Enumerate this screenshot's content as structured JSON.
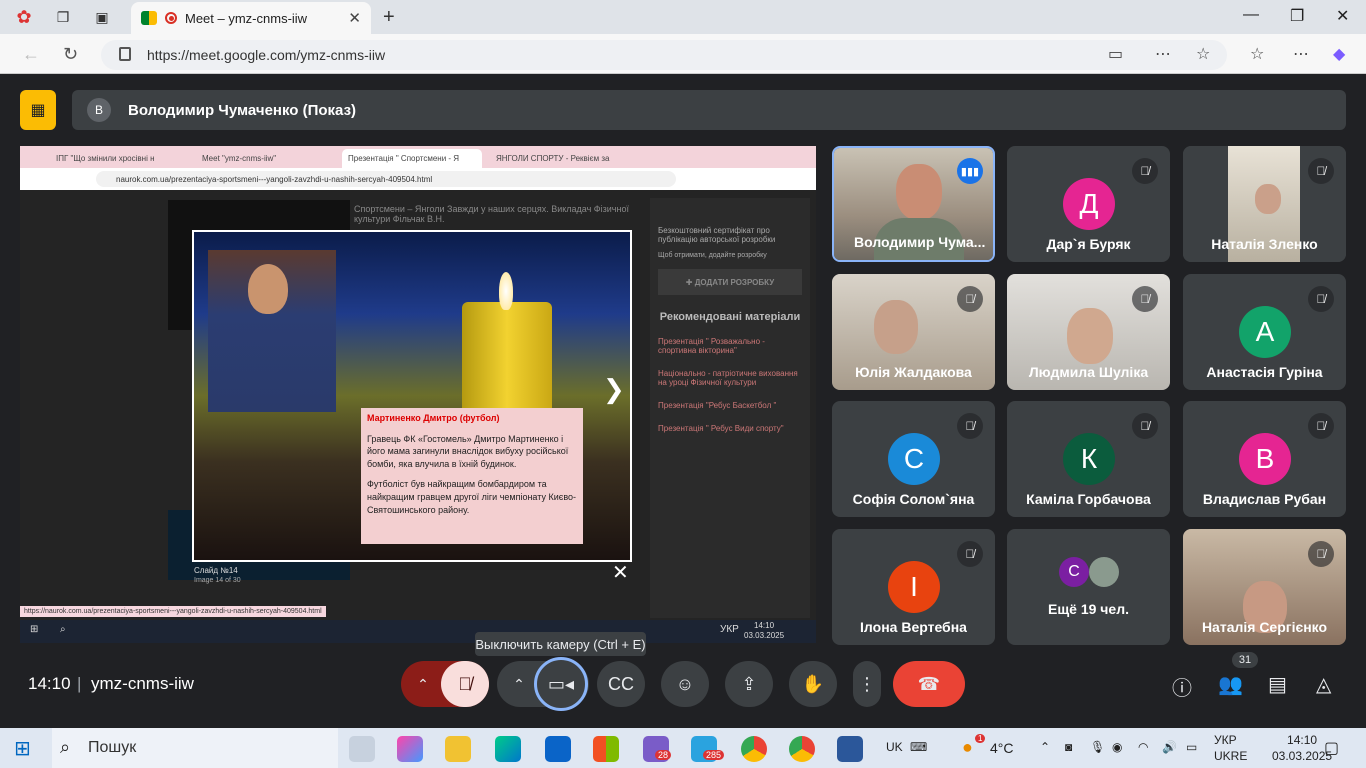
{
  "browser": {
    "tab_title": "Meet – ymz-cnms-iiw",
    "url": "https://meet.google.com/ymz-cnms-iiw"
  },
  "presenter": {
    "initial": "В",
    "label": "Володимир Чумаченко (Показ)"
  },
  "shared_screen": {
    "tabs": [
      "ІПГ \"Що змінили хросівні н",
      "Meet \"ymz-cnms-iiw\"",
      "Презентація \" Спортсмени - Я",
      "ЯНГОЛИ СПОРТУ - Реквієм за"
    ],
    "url": "naurok.com.ua/prezentaciya-sportsmeni---yangoli-zavzhdi-u-nashih-sercyah-409504.html",
    "page_text": "Спортсмени – Янголи Завжди у наших серцях. Викладач Фізичної культури Фільчак В.Н.",
    "sidebar_text": "Безкоштовний сертифікат про публікацію авторської розробки",
    "sidebar_small": "Щоб отримати, додайте розробку",
    "add_button": "✚ ДОДАТИ РОЗРОБКУ",
    "recommended_title": "Рекомендовані матеріали",
    "recommended": [
      "Презентація \" Розважально - спортивна вікторина\"",
      "Національно - патріотичне виховання на уроці Фізичної культури",
      "Презентація \"Ребус Баскетбол \"",
      "Презентація \" Ребус Види спорту\""
    ],
    "slide": {
      "title": "Мартиненко Дмитро (футбол)",
      "p1": "Гравець ФК «Гостомель» Дмитро Мартиненко і його мама загинули внаслідок вибуху російської бомби, яка влучила в їхній будинок.",
      "p2": "Футболіст був найкращим бомбардиром та найкращим гравцем другої ліги чемпіонату Києво-Святошинського району."
    },
    "slide_caption": "Слайд №14",
    "slide_counter": "Image 14 of 30",
    "status_url": "https://naurok.com.ua/prezentaciya-sportsmeni---yangoli-zavzhdi-u-nashih-sercyah-409504.html",
    "taskbar_lang": "УКР",
    "taskbar_time": "14:10",
    "taskbar_date": "03.03.2025"
  },
  "participants": [
    {
      "name": "Володимир Чума...",
      "type": "video",
      "speaking": true
    },
    {
      "name": "Дар`я Буряк",
      "initial": "Д",
      "color": "#e52592"
    },
    {
      "name": "Наталія Зленко",
      "type": "video"
    },
    {
      "name": "Юлія Жалдакова",
      "type": "video"
    },
    {
      "name": "Людмила Шуліка",
      "type": "video"
    },
    {
      "name": "Анастасія Гуріна",
      "initial": "А",
      "color": "#12a36a"
    },
    {
      "name": "Софія Солом`яна",
      "initial": "С",
      "color": "#1a8ad8"
    },
    {
      "name": "Каміла Горбачова",
      "initial": "К",
      "color": "#0b5c3d"
    },
    {
      "name": "Владислав Рубан",
      "initial": "В",
      "color": "#e52592"
    },
    {
      "name": "Ілона Вертебна",
      "initial": "І",
      "color": "#e8430f"
    },
    {
      "name": "Ещё 19 чел.",
      "initial": "С",
      "color": "#7b1fa2"
    },
    {
      "name": "Наталія Сергієнко",
      "type": "video"
    }
  ],
  "controls": {
    "time": "14:10",
    "meeting_code": "ymz-cnms-iiw",
    "tooltip": "Выключить камеру (Ctrl + E)",
    "people_count": "31"
  },
  "taskbar": {
    "search": "Пошук",
    "lang": "УКР",
    "lang2": "UKRE",
    "time": "14:10",
    "date": "03.03.2025",
    "temp": "4°C",
    "uk": "UK",
    "badge1": "28",
    "badge2": "285",
    "weather_badge": "1"
  }
}
